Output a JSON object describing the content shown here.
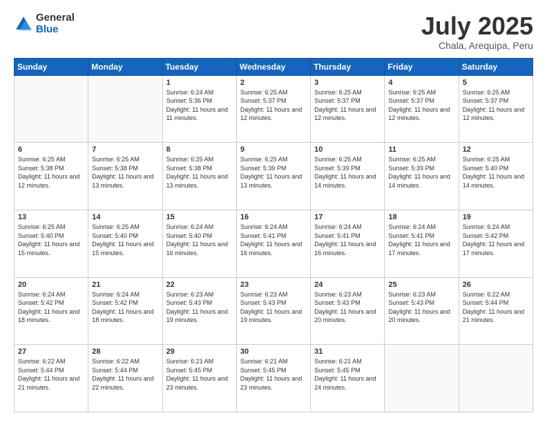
{
  "logo": {
    "general": "General",
    "blue": "Blue"
  },
  "header": {
    "title": "July 2025",
    "subtitle": "Chala, Arequipa, Peru"
  },
  "weekdays": [
    "Sunday",
    "Monday",
    "Tuesday",
    "Wednesday",
    "Thursday",
    "Friday",
    "Saturday"
  ],
  "weeks": [
    [
      {
        "day": "",
        "sunrise": "",
        "sunset": "",
        "daylight": ""
      },
      {
        "day": "",
        "sunrise": "",
        "sunset": "",
        "daylight": ""
      },
      {
        "day": "1",
        "sunrise": "Sunrise: 6:24 AM",
        "sunset": "Sunset: 5:36 PM",
        "daylight": "Daylight: 11 hours and 11 minutes."
      },
      {
        "day": "2",
        "sunrise": "Sunrise: 6:25 AM",
        "sunset": "Sunset: 5:37 PM",
        "daylight": "Daylight: 11 hours and 12 minutes."
      },
      {
        "day": "3",
        "sunrise": "Sunrise: 6:25 AM",
        "sunset": "Sunset: 5:37 PM",
        "daylight": "Daylight: 11 hours and 12 minutes."
      },
      {
        "day": "4",
        "sunrise": "Sunrise: 6:25 AM",
        "sunset": "Sunset: 5:37 PM",
        "daylight": "Daylight: 11 hours and 12 minutes."
      },
      {
        "day": "5",
        "sunrise": "Sunrise: 6:25 AM",
        "sunset": "Sunset: 5:37 PM",
        "daylight": "Daylight: 11 hours and 12 minutes."
      }
    ],
    [
      {
        "day": "6",
        "sunrise": "Sunrise: 6:25 AM",
        "sunset": "Sunset: 5:38 PM",
        "daylight": "Daylight: 11 hours and 12 minutes."
      },
      {
        "day": "7",
        "sunrise": "Sunrise: 6:25 AM",
        "sunset": "Sunset: 5:38 PM",
        "daylight": "Daylight: 11 hours and 13 minutes."
      },
      {
        "day": "8",
        "sunrise": "Sunrise: 6:25 AM",
        "sunset": "Sunset: 5:38 PM",
        "daylight": "Daylight: 11 hours and 13 minutes."
      },
      {
        "day": "9",
        "sunrise": "Sunrise: 6:25 AM",
        "sunset": "Sunset: 5:39 PM",
        "daylight": "Daylight: 11 hours and 13 minutes."
      },
      {
        "day": "10",
        "sunrise": "Sunrise: 6:25 AM",
        "sunset": "Sunset: 5:39 PM",
        "daylight": "Daylight: 11 hours and 14 minutes."
      },
      {
        "day": "11",
        "sunrise": "Sunrise: 6:25 AM",
        "sunset": "Sunset: 5:39 PM",
        "daylight": "Daylight: 11 hours and 14 minutes."
      },
      {
        "day": "12",
        "sunrise": "Sunrise: 6:25 AM",
        "sunset": "Sunset: 5:40 PM",
        "daylight": "Daylight: 11 hours and 14 minutes."
      }
    ],
    [
      {
        "day": "13",
        "sunrise": "Sunrise: 6:25 AM",
        "sunset": "Sunset: 5:40 PM",
        "daylight": "Daylight: 11 hours and 15 minutes."
      },
      {
        "day": "14",
        "sunrise": "Sunrise: 6:25 AM",
        "sunset": "Sunset: 5:40 PM",
        "daylight": "Daylight: 11 hours and 15 minutes."
      },
      {
        "day": "15",
        "sunrise": "Sunrise: 6:24 AM",
        "sunset": "Sunset: 5:40 PM",
        "daylight": "Daylight: 11 hours and 16 minutes."
      },
      {
        "day": "16",
        "sunrise": "Sunrise: 6:24 AM",
        "sunset": "Sunset: 5:41 PM",
        "daylight": "Daylight: 11 hours and 16 minutes."
      },
      {
        "day": "17",
        "sunrise": "Sunrise: 6:24 AM",
        "sunset": "Sunset: 5:41 PM",
        "daylight": "Daylight: 11 hours and 16 minutes."
      },
      {
        "day": "18",
        "sunrise": "Sunrise: 6:24 AM",
        "sunset": "Sunset: 5:41 PM",
        "daylight": "Daylight: 11 hours and 17 minutes."
      },
      {
        "day": "19",
        "sunrise": "Sunrise: 6:24 AM",
        "sunset": "Sunset: 5:42 PM",
        "daylight": "Daylight: 11 hours and 17 minutes."
      }
    ],
    [
      {
        "day": "20",
        "sunrise": "Sunrise: 6:24 AM",
        "sunset": "Sunset: 5:42 PM",
        "daylight": "Daylight: 11 hours and 18 minutes."
      },
      {
        "day": "21",
        "sunrise": "Sunrise: 6:24 AM",
        "sunset": "Sunset: 5:42 PM",
        "daylight": "Daylight: 11 hours and 18 minutes."
      },
      {
        "day": "22",
        "sunrise": "Sunrise: 6:23 AM",
        "sunset": "Sunset: 5:43 PM",
        "daylight": "Daylight: 11 hours and 19 minutes."
      },
      {
        "day": "23",
        "sunrise": "Sunrise: 6:23 AM",
        "sunset": "Sunset: 5:43 PM",
        "daylight": "Daylight: 11 hours and 19 minutes."
      },
      {
        "day": "24",
        "sunrise": "Sunrise: 6:23 AM",
        "sunset": "Sunset: 5:43 PM",
        "daylight": "Daylight: 11 hours and 20 minutes."
      },
      {
        "day": "25",
        "sunrise": "Sunrise: 6:23 AM",
        "sunset": "Sunset: 5:43 PM",
        "daylight": "Daylight: 11 hours and 20 minutes."
      },
      {
        "day": "26",
        "sunrise": "Sunrise: 6:22 AM",
        "sunset": "Sunset: 5:44 PM",
        "daylight": "Daylight: 11 hours and 21 minutes."
      }
    ],
    [
      {
        "day": "27",
        "sunrise": "Sunrise: 6:22 AM",
        "sunset": "Sunset: 5:44 PM",
        "daylight": "Daylight: 11 hours and 21 minutes."
      },
      {
        "day": "28",
        "sunrise": "Sunrise: 6:22 AM",
        "sunset": "Sunset: 5:44 PM",
        "daylight": "Daylight: 11 hours and 22 minutes."
      },
      {
        "day": "29",
        "sunrise": "Sunrise: 6:21 AM",
        "sunset": "Sunset: 5:45 PM",
        "daylight": "Daylight: 11 hours and 23 minutes."
      },
      {
        "day": "30",
        "sunrise": "Sunrise: 6:21 AM",
        "sunset": "Sunset: 5:45 PM",
        "daylight": "Daylight: 11 hours and 23 minutes."
      },
      {
        "day": "31",
        "sunrise": "Sunrise: 6:21 AM",
        "sunset": "Sunset: 5:45 PM",
        "daylight": "Daylight: 11 hours and 24 minutes."
      },
      {
        "day": "",
        "sunrise": "",
        "sunset": "",
        "daylight": ""
      },
      {
        "day": "",
        "sunrise": "",
        "sunset": "",
        "daylight": ""
      }
    ]
  ]
}
